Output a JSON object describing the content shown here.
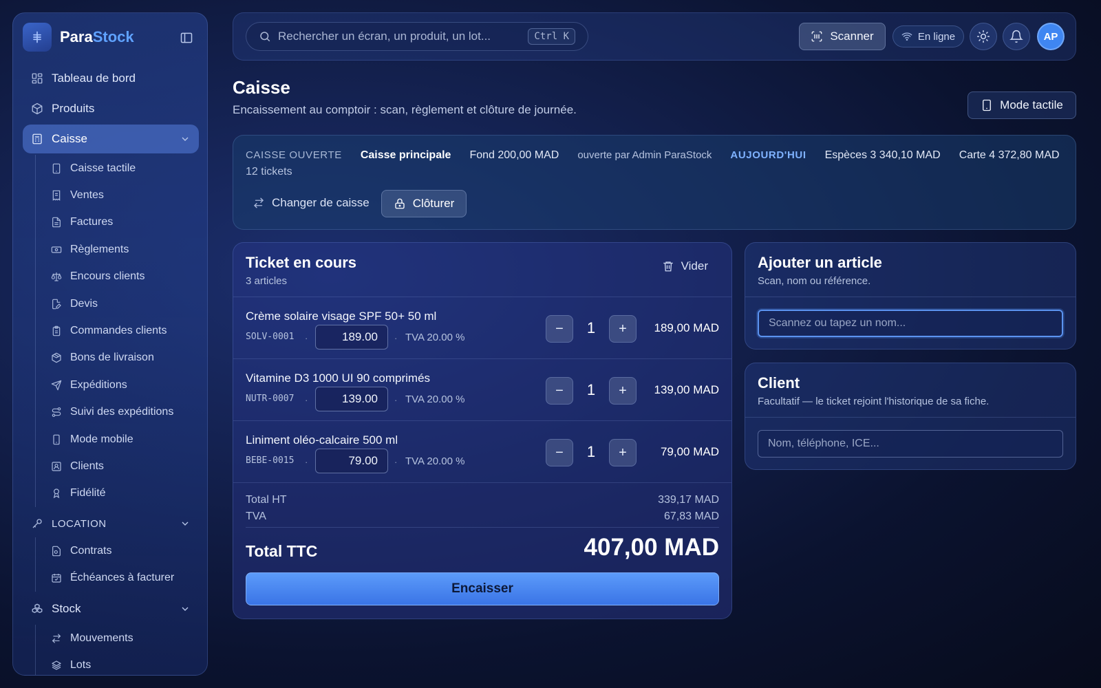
{
  "brand": {
    "name_part1": "Para",
    "name_part2": "Stock"
  },
  "sidebar": {
    "main_items": [
      {
        "label": "Tableau de bord",
        "icon": "dashboard-icon"
      },
      {
        "label": "Produits",
        "icon": "box-icon"
      },
      {
        "label": "Caisse",
        "icon": "register-icon",
        "active": true
      }
    ],
    "caisse_sub": [
      {
        "label": "Caisse tactile",
        "icon": "tablet-icon"
      },
      {
        "label": "Ventes",
        "icon": "receipt-icon"
      },
      {
        "label": "Factures",
        "icon": "file-icon"
      },
      {
        "label": "Règlements",
        "icon": "banknote-icon"
      },
      {
        "label": "Encours clients",
        "icon": "scale-icon"
      },
      {
        "label": "Devis",
        "icon": "file-pen-icon"
      },
      {
        "label": "Commandes clients",
        "icon": "clipboard-icon"
      },
      {
        "label": "Bons de livraison",
        "icon": "package-icon"
      },
      {
        "label": "Expéditions",
        "icon": "send-icon"
      },
      {
        "label": "Suivi des expéditions",
        "icon": "route-icon"
      },
      {
        "label": "Mode mobile",
        "icon": "smartphone-icon"
      },
      {
        "label": "Clients",
        "icon": "contact-icon"
      },
      {
        "label": "Fidélité",
        "icon": "award-icon"
      }
    ],
    "location_section": {
      "label": "LOCATION",
      "icon": "key-icon"
    },
    "location_sub": [
      {
        "label": "Contrats",
        "icon": "contract-icon"
      },
      {
        "label": "Échéances à facturer",
        "icon": "calendar-icon"
      }
    ],
    "stock_item": {
      "label": "Stock",
      "icon": "boxes-icon"
    },
    "stock_sub": [
      {
        "label": "Mouvements",
        "icon": "arrows-icon"
      },
      {
        "label": "Lots",
        "icon": "layers-icon"
      }
    ]
  },
  "topbar": {
    "search_placeholder": "Rechercher un écran, un produit, un lot...",
    "search_shortcut": "Ctrl K",
    "scan_label": "Scanner",
    "online_label": "En ligne",
    "avatar_initials": "AP"
  },
  "page": {
    "title": "Caisse",
    "subtitle": "Encaissement au comptoir : scan, règlement et clôture de journée.",
    "tactile_button": "Mode tactile"
  },
  "register": {
    "status": "CAISSE OUVERTE",
    "name": "Caisse principale",
    "fund": "Fond 200,00 MAD",
    "opened_by": "ouverte par Admin ParaStock",
    "when": "AUJOURD'HUI",
    "cash": "Espèces 3 340,10 MAD",
    "card": "Carte 4 372,80 MAD",
    "tickets": "12 tickets",
    "change_label": "Changer de caisse",
    "close_label": "Clôturer"
  },
  "ticket": {
    "title": "Ticket en cours",
    "count": "3 articles",
    "clear_label": "Vider",
    "lines": [
      {
        "name": "Crème solaire visage SPF 50+ 50 ml",
        "ref": "SOLV-0001",
        "price": "189.00",
        "vat": "TVA 20.00 %",
        "qty": "1",
        "total": "189,00 MAD"
      },
      {
        "name": "Vitamine D3 1000 UI 90 comprimés",
        "ref": "NUTR-0007",
        "price": "139.00",
        "vat": "TVA 20.00 %",
        "qty": "1",
        "total": "139,00 MAD"
      },
      {
        "name": "Liniment oléo-calcaire 500 ml",
        "ref": "BEBE-0015",
        "price": "79.00",
        "vat": "TVA 20.00 %",
        "qty": "1",
        "total": "79,00 MAD"
      }
    ],
    "total_ht_label": "Total HT",
    "total_ht": "339,17 MAD",
    "tva_label": "TVA",
    "tva": "67,83 MAD",
    "total_ttc_label": "Total TTC",
    "total_ttc": "407,00 MAD",
    "pay_label": "Encaisser"
  },
  "add_article": {
    "title": "Ajouter un article",
    "subtitle": "Scan, nom ou référence.",
    "placeholder": "Scannez ou tapez un nom..."
  },
  "client": {
    "title": "Client",
    "subtitle": "Facultatif — le ticket rejoint l'historique de sa fiche.",
    "placeholder": "Nom, téléphone, ICE..."
  },
  "colors": {
    "accent": "#3f86f2",
    "highlight": "#7fb2ff",
    "pay_button": "#4a88f0"
  }
}
